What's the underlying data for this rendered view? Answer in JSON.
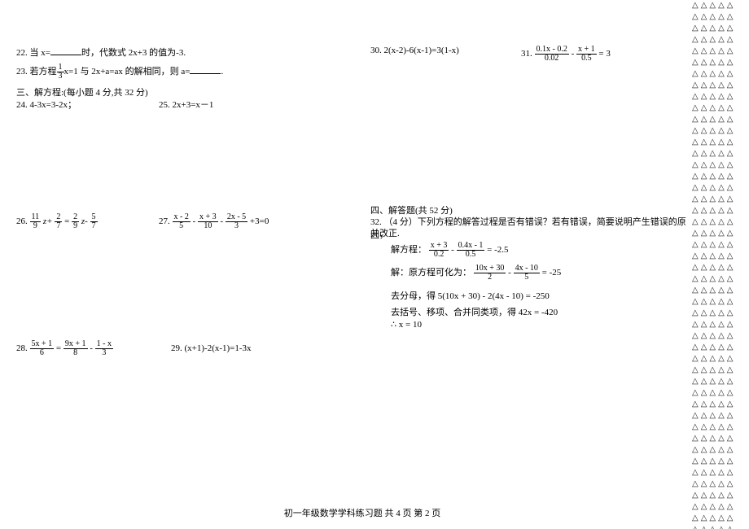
{
  "q22": {
    "prefix": "22. 当 x=",
    "suffix": "时，代数式 2x+3 的值为-3."
  },
  "q23": {
    "prefix": "23. 若方程",
    "frac_num": "1",
    "frac_den": "3",
    "mid": "x=1 与 2x+a=ax 的解相同，则 a=",
    "end": "."
  },
  "section3": "三、解方程:(每小题 4 分,共 32 分)",
  "q24": "24. 4-3x=3-2x；",
  "q25": "25. 2x+3=x－1",
  "q26": {
    "no": "26.",
    "p1n": "11",
    "p1d": "9",
    "z": "z+",
    "p2n": "2",
    "p2d": "7",
    "eq": "=",
    "p3n": "2",
    "p3d": "9",
    "z2": "z-",
    "p4n": "5",
    "p4d": "7"
  },
  "q27": {
    "no": "27.",
    "p1n": "x - 2",
    "p1d": "5",
    "m1": "-",
    "p2n": "x + 3",
    "p2d": "10",
    "m2": "-",
    "p3n": "2x - 5",
    "p3d": "3",
    "end": "+3=0"
  },
  "q28": {
    "no": "28.",
    "p1n": "5x + 1",
    "p1d": "6",
    "eq": "=",
    "p2n": "9x + 1",
    "p2d": "8",
    "m": "-",
    "p3n": "1 - x",
    "p3d": "3"
  },
  "q29": "29. (x+1)-2(x-1)=1-3x",
  "q30": "30. 2(x-2)-6(x-1)=3(1-x)",
  "q31": {
    "no": "31.",
    "p1n": "0.1x - 0.2",
    "p1d": "0.02",
    "m": "-",
    "p2n": "x + 1",
    "p2d": "0.5",
    "end": "= 3"
  },
  "section4": "四、解答题(共 52 分)",
  "q32": {
    "header": "32. （4 分）下列方程的解答过程是否有错误？若有错误，简要说明产生错误的原因，",
    "header2": "并改正.",
    "line1_pre": "解方程：",
    "line1_f1n": "x + 3",
    "line1_f1d": "0.2",
    "line1_m": " - ",
    "line1_f2n": "0.4x - 1",
    "line1_f2d": "0.5",
    "line1_end": " = -2.5",
    "line2_pre": "解：原方程可化为：",
    "line2_f1n": "10x + 30",
    "line2_f1d": "2",
    "line2_m": " - ",
    "line2_f2n": "4x - 10",
    "line2_f2d": "5",
    "line2_end": " = -25",
    "line3": "去分母，得  5(10x + 30) - 2(4x - 10) = -250",
    "line4": "去括号、移项、合并同类项，得  42x = -420",
    "line5": "∴ x = 10"
  },
  "footer": "初一年级数学学科练习题   共 4 页   第 2 页",
  "tri_row": "△△△△△"
}
